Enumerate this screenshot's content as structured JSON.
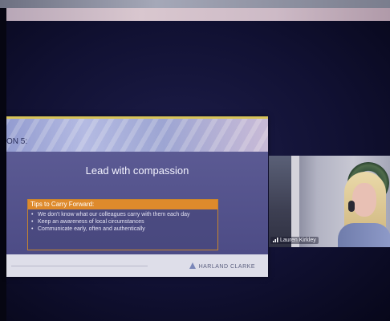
{
  "slide": {
    "section_label": "ON 5:",
    "title": "Lead with compassion",
    "tips_header": "Tips to Carry Forward:",
    "tips": [
      "We don't know what our colleagues carry with them each day",
      "Keep an awareness of local circumstances",
      "Communicate early, often and authentically"
    ],
    "brand": "HARLAND CLARKE"
  },
  "participant": {
    "name": "Lauren Kirkley"
  },
  "colors": {
    "slide_body": "#54528a",
    "tips_header": "#de8a2c",
    "footer": "#dedee9"
  },
  "icons": {
    "brand_logo": "brand-logo-icon",
    "signal": "signal-bars-icon"
  }
}
